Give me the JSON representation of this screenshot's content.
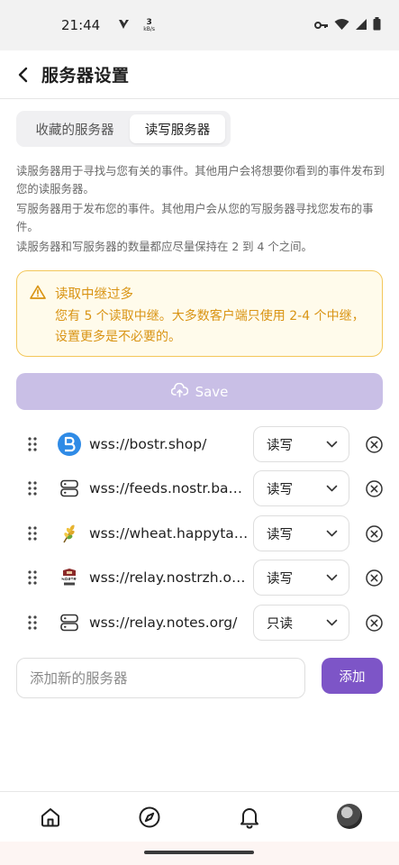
{
  "status_bar": {
    "time": "21:44",
    "speed_value": "3",
    "speed_unit": "kB/s",
    "icons": [
      "signal-v-icon",
      "key-icon",
      "wifi-icon",
      "cell-signal-icon",
      "battery-icon"
    ]
  },
  "header": {
    "title": "服务器设置"
  },
  "tabs": [
    {
      "label": "收藏的服务器",
      "active": false
    },
    {
      "label": "读写服务器",
      "active": true
    }
  ],
  "description": {
    "line1": "读服务器用于寻找与您有关的事件。其他用户会将想要你看到的事件发布到您的读服务器。",
    "line2": "写服务器用于发布您的事件。其他用户会从您的写服务器寻找您发布的事件。",
    "line3": "读服务器和写服务器的数量都应尽量保持在 2 到 4 个之间。"
  },
  "warning": {
    "title": "读取中继过多",
    "body": "您有 5 个读取中继。大多数客户端只使用 2-4 个中继，设置更多是不必要的。",
    "color": "#d99414"
  },
  "save_button": {
    "label": "Save"
  },
  "servers": [
    {
      "url": "wss://bostr.shop/",
      "mode": "读写",
      "icon": "bostr-logo-icon"
    },
    {
      "url": "wss://feeds.nostr.band/popular",
      "mode": "读写",
      "icon": "server-icon"
    },
    {
      "url": "wss://wheat.happytavern.co/",
      "mode": "读写",
      "icon": "wheat-icon"
    },
    {
      "url": "wss://relay.nostrzh.org/",
      "mode": "读写",
      "icon": "nostr-logo-icon"
    },
    {
      "url": "wss://relay.notes.org/",
      "mode": "只读",
      "icon": "server-icon"
    }
  ],
  "add_server": {
    "placeholder": "添加新的服务器",
    "button_label": "添加"
  },
  "bottom_nav": {
    "items": [
      "home-icon",
      "compass-icon",
      "bell-icon",
      "avatar"
    ]
  },
  "colors": {
    "accent": "#7d55c7",
    "save_disabled": "#c9bfe6",
    "warning_bg": "#fffbeb",
    "warning_border": "#f3c75a"
  }
}
